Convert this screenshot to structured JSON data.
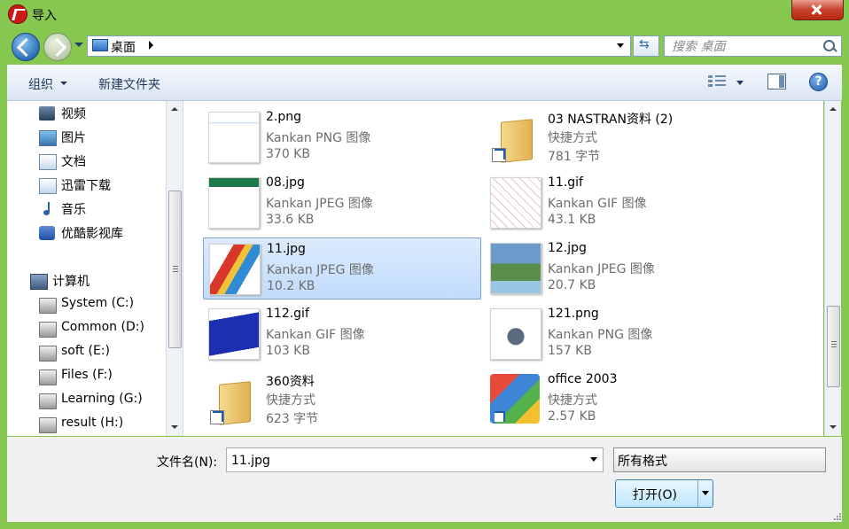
{
  "window": {
    "title": "导入",
    "accent": "#86c84f"
  },
  "navbar": {
    "address": "桌面",
    "search_placeholder": "搜索 桌面"
  },
  "toolbar": {
    "organize": "组织",
    "new_folder": "新建文件夹"
  },
  "nav_pane": {
    "items": [
      {
        "label": "视频",
        "icon": "video-icon"
      },
      {
        "label": "图片",
        "icon": "pictures-icon"
      },
      {
        "label": "文档",
        "icon": "documents-icon"
      },
      {
        "label": "迅雷下载",
        "icon": "download-folder-icon"
      },
      {
        "label": "音乐",
        "icon": "music-icon"
      },
      {
        "label": "优酷影视库",
        "icon": "youku-icon"
      },
      {
        "label": "计算机",
        "icon": "computer-icon"
      },
      {
        "label": "System (C:)",
        "icon": "system-drive-icon"
      },
      {
        "label": "Common (D:)",
        "icon": "drive-icon"
      },
      {
        "label": "soft (E:)",
        "icon": "drive-icon"
      },
      {
        "label": "Files (F:)",
        "icon": "drive-icon"
      },
      {
        "label": "Learning (G:)",
        "icon": "drive-icon"
      },
      {
        "label": "result (H:)",
        "icon": "drive-icon"
      }
    ]
  },
  "files": [
    {
      "name": "2.png",
      "type": "Kankan PNG 图像",
      "size": "370 KB",
      "thumb": "image-thumbnail"
    },
    {
      "name": "03 NASTRAN资料 (2)",
      "type": "快捷方式",
      "size": "781 字节",
      "thumb": "folder-shortcut-icon"
    },
    {
      "name": "08.jpg",
      "type": "Kankan JPEG 图像",
      "size": "33.6 KB",
      "thumb": "image-thumbnail"
    },
    {
      "name": "11.gif",
      "type": "Kankan GIF 图像",
      "size": "43.1 KB",
      "thumb": "image-thumbnail"
    },
    {
      "name": "11.jpg",
      "type": "Kankan JPEG 图像",
      "size": "10.2 KB",
      "thumb": "image-thumbnail",
      "selected": true
    },
    {
      "name": "12.jpg",
      "type": "Kankan JPEG 图像",
      "size": "20.7 KB",
      "thumb": "image-thumbnail"
    },
    {
      "name": "112.gif",
      "type": "Kankan GIF 图像",
      "size": "103 KB",
      "thumb": "image-thumbnail"
    },
    {
      "name": "121.png",
      "type": "Kankan PNG 图像",
      "size": "157 KB",
      "thumb": "image-thumbnail"
    },
    {
      "name": "360资料",
      "type": "快捷方式",
      "size": "623 字节",
      "thumb": "folder-shortcut-icon"
    },
    {
      "name": "office 2003",
      "type": "快捷方式",
      "size": "2.57 KB",
      "thumb": "office-shortcut-icon"
    }
  ],
  "bottom": {
    "filename_label": "文件名(N):",
    "filename_value": "11.jpg",
    "filter": "所有格式",
    "open_label": "打开(O)"
  }
}
